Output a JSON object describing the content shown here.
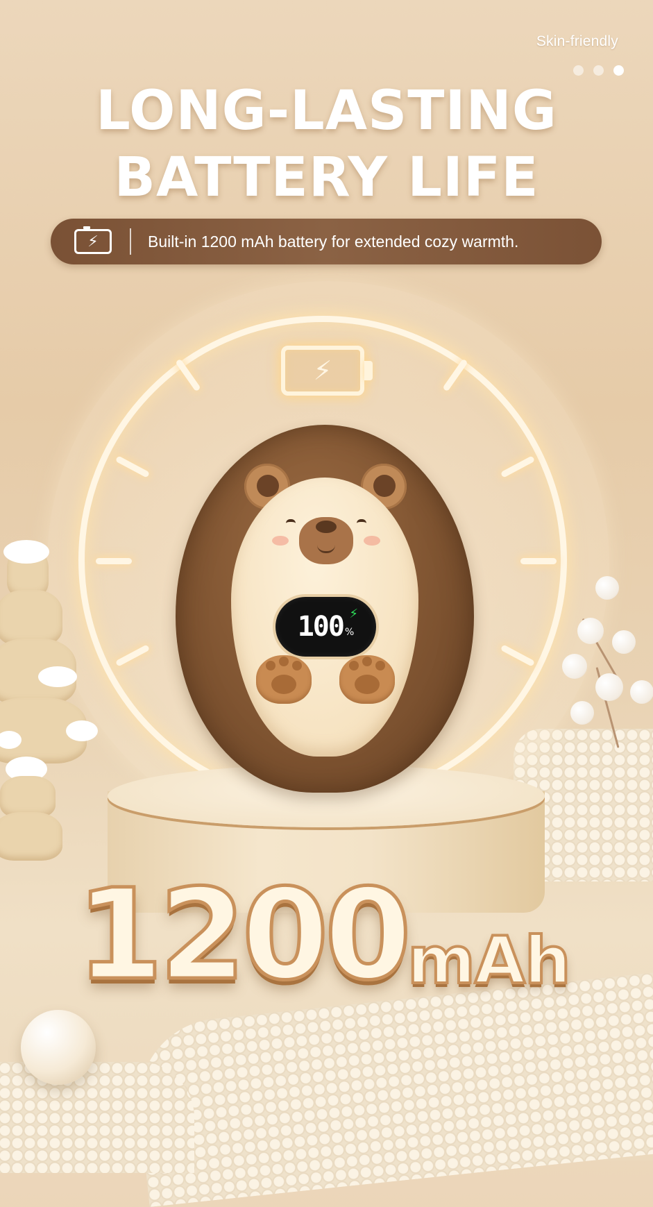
{
  "pager": {
    "label": "Skin-friendly",
    "dots": 3,
    "active_index": 2
  },
  "headline": {
    "line1": "LONG-LASTING",
    "line2": "BATTERY LIFE"
  },
  "feature_pill": {
    "icon": "battery-charging-icon",
    "text": "Built-in 1200 mAh battery for extended cozy warmth."
  },
  "dial": {
    "icon": "battery-charging-icon"
  },
  "device_display": {
    "value": "100",
    "unit": "%",
    "charging_icon": "lightning-bolt-icon"
  },
  "capacity": {
    "value": "1200",
    "unit": "mAh"
  },
  "colors": {
    "accent": "#7a5135",
    "background": "#e6cba8",
    "glow": "#fff6e4",
    "charging_green": "#2ee05a"
  }
}
